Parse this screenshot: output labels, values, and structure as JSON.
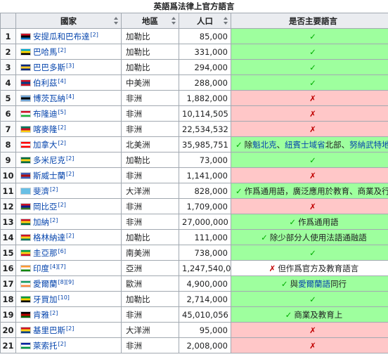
{
  "caption": "英語爲法律上官方語言",
  "headers": {
    "rank": "",
    "country": "國家",
    "region": "地區",
    "population": "人口",
    "status": "是否主要語言"
  },
  "rows": [
    {
      "n": "1",
      "country": "安提瓜和巴布達",
      "ref": "[2]",
      "region": "加勒比",
      "pop": "85,000",
      "kind": "yes",
      "mark": "✓",
      "text": "",
      "flag": [
        "#ce1126",
        "#000000",
        "#0072c6"
      ]
    },
    {
      "n": "2",
      "country": "巴哈馬",
      "ref": "[2]",
      "region": "加勒比",
      "pop": "331,000",
      "kind": "yes",
      "mark": "✓",
      "text": "",
      "flag": [
        "#00abc9",
        "#ffd700",
        "#000000"
      ]
    },
    {
      "n": "3",
      "country": "巴巴多斯",
      "ref": "[3]",
      "region": "加勒比",
      "pop": "294,000",
      "kind": "yes",
      "mark": "✓",
      "text": "",
      "flag": [
        "#00267f",
        "#ffc726",
        "#00267f"
      ]
    },
    {
      "n": "4",
      "country": "伯利茲",
      "ref": "[4]",
      "region": "中美洲",
      "pop": "288,000",
      "kind": "yes",
      "mark": "✓",
      "text": "",
      "flag": [
        "#ce1126",
        "#003f87",
        "#ce1126"
      ]
    },
    {
      "n": "5",
      "country": "博茨瓦納",
      "ref": "[4]",
      "region": "非洲",
      "pop": "1,882,000",
      "kind": "no",
      "mark": "✗",
      "text": "",
      "flag": [
        "#75aadb",
        "#000000",
        "#75aadb"
      ]
    },
    {
      "n": "6",
      "country": "布隆迪",
      "ref": "[5]",
      "region": "非洲",
      "pop": "10,114,505",
      "kind": "no",
      "mark": "✗",
      "text": "",
      "flag": [
        "#ce1126",
        "#ffffff",
        "#1eb53a"
      ]
    },
    {
      "n": "7",
      "country": "喀麥隆",
      "ref": "[2]",
      "region": "非洲",
      "pop": "22,534,532",
      "kind": "no",
      "mark": "✗",
      "text": "",
      "flag": [
        "#007a5e",
        "#ce1126",
        "#fcd116"
      ]
    },
    {
      "n": "8",
      "country": "加拿大",
      "ref": "[2]",
      "region": "北美洲",
      "pop": "35,985,751",
      "kind": "yes-lead",
      "mark": "✓",
      "text_parts": [
        "除",
        "魁北克",
        "、",
        "紐賓士域省",
        "北部、",
        "努納武特地區外"
      ],
      "flag": [
        "#ff0000",
        "#ffffff",
        "#ff0000"
      ]
    },
    {
      "n": "9",
      "country": "多米尼克",
      "ref": "[2]",
      "region": "加勒比",
      "pop": "73,000",
      "kind": "yes",
      "mark": "✓",
      "text": "",
      "flag": [
        "#006b3f",
        "#fcd116",
        "#006b3f"
      ]
    },
    {
      "n": "10",
      "country": "斯威士蘭",
      "ref": "[2]",
      "region": "非洲",
      "pop": "1,141,000",
      "kind": "no",
      "mark": "✗",
      "text": "",
      "flag": [
        "#3e5eb9",
        "#b10c0c",
        "#3e5eb9"
      ]
    },
    {
      "n": "11",
      "country": "斐濟",
      "ref": "[2]",
      "region": "大洋洲",
      "pop": "828,000",
      "kind": "yes",
      "mark": "✓",
      "text": "作爲通用語，廣泛應用於教育、商業及行政",
      "flag": [
        "#68bfe5",
        "#68bfe5",
        "#68bfe5"
      ]
    },
    {
      "n": "12",
      "country": "岡比亞",
      "ref": "[2]",
      "region": "非洲",
      "pop": "1,709,000",
      "kind": "no",
      "mark": "✗",
      "text": "",
      "flag": [
        "#ce1126",
        "#0c1c8c",
        "#3a7728"
      ]
    },
    {
      "n": "13",
      "country": "加納",
      "ref": "[2]",
      "region": "非洲",
      "pop": "27,000,000",
      "kind": "yes",
      "mark": "✓",
      "text": "作爲通用語",
      "flag": [
        "#ce1126",
        "#fcd116",
        "#006b3f"
      ]
    },
    {
      "n": "14",
      "country": "格林納達",
      "ref": "[2]",
      "region": "加勒比",
      "pop": "111,000",
      "kind": "yes",
      "mark": "✓",
      "text": "除少部分人使用法語通融語",
      "flag": [
        "#ce1126",
        "#fcd116",
        "#007a5e"
      ]
    },
    {
      "n": "15",
      "country": "圭亞那",
      "ref": "[6]",
      "region": "南美洲",
      "pop": "738,000",
      "kind": "yes",
      "mark": "✓",
      "text": "",
      "flag": [
        "#009e49",
        "#fcd116",
        "#ce1126"
      ]
    },
    {
      "n": "16",
      "country": "印度",
      "ref": "[4][7]",
      "region": "亞洲",
      "pop": "1,247,540,000",
      "kind": "partial",
      "mark": "✗",
      "text": "但作爲官方及教育語言",
      "flag": [
        "#ff9933",
        "#ffffff",
        "#138808"
      ]
    },
    {
      "n": "17",
      "country": "愛爾蘭",
      "ref": "[8][9]",
      "region": "歐洲",
      "pop": "4,900,000",
      "kind": "yes-irish",
      "mark": "✓",
      "text_parts": [
        "與",
        "愛爾蘭語",
        "同行"
      ],
      "flag": [
        "#169b62",
        "#ffffff",
        "#ff883e"
      ]
    },
    {
      "n": "18",
      "country": "牙買加",
      "ref": "[10]",
      "region": "加勒比",
      "pop": "2,714,000",
      "kind": "yes",
      "mark": "✓",
      "text": "",
      "flag": [
        "#009b3a",
        "#fed100",
        "#000000"
      ]
    },
    {
      "n": "19",
      "country": "肯雅",
      "ref": "[2]",
      "region": "非洲",
      "pop": "45,010,056",
      "kind": "yes",
      "mark": "✓",
      "text": "商業及教育上",
      "flag": [
        "#000000",
        "#bb0000",
        "#006600"
      ]
    },
    {
      "n": "20",
      "country": "基里巴斯",
      "ref": "[2]",
      "region": "大洋洲",
      "pop": "95,000",
      "kind": "no",
      "mark": "✗",
      "text": "",
      "flag": [
        "#ce1126",
        "#fcd116",
        "#003f87"
      ]
    },
    {
      "n": "21",
      "country": "萊索托",
      "ref": "[2]",
      "region": "非洲",
      "pop": "2,008,000",
      "kind": "no",
      "mark": "✗",
      "text": "",
      "flag": [
        "#00209f",
        "#ffffff",
        "#009543"
      ]
    }
  ]
}
